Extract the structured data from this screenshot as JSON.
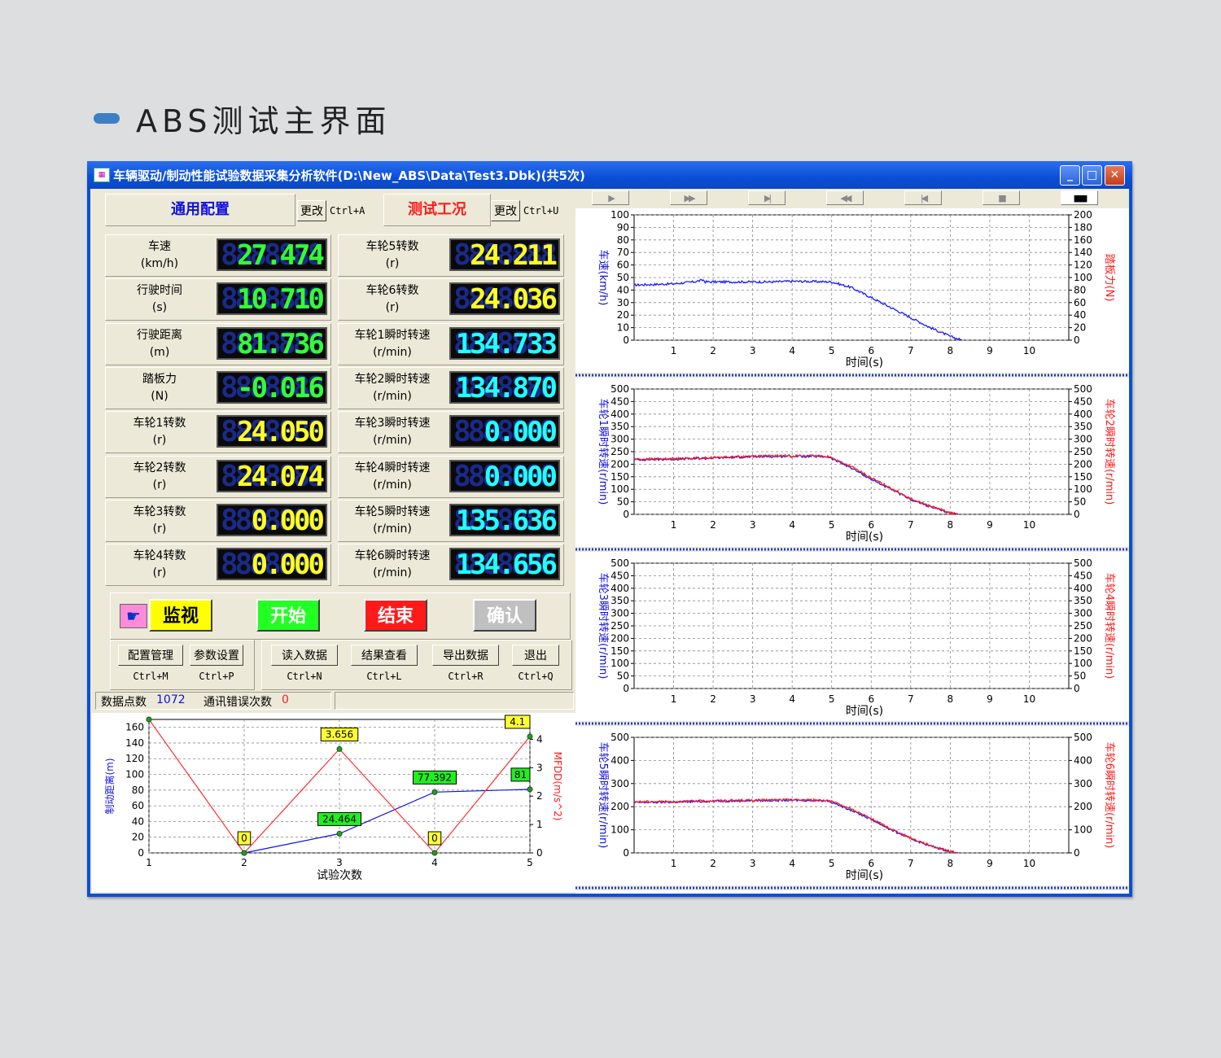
{
  "caption": "ABS测试主界面",
  "window": {
    "title": "车辆驱动/制动性能试验数据采集分析软件(D:\\New_ABS\\Data\\Test3.Dbk)(共5次)",
    "controls": {
      "minimize": "_",
      "maximize": "□",
      "close": "✕"
    }
  },
  "config": {
    "general_label": "通用配置",
    "general_change": "更改",
    "general_hotkey": "Ctrl+A",
    "test_label": "测试工况",
    "test_change": "更改",
    "test_hotkey": "Ctrl+U"
  },
  "meters": [
    {
      "label": "车速",
      "unit": "(km/h)",
      "value": "27.474",
      "color": "#33ff33"
    },
    {
      "label": "车轮5转数",
      "unit": "(r)",
      "value": "24.211",
      "color": "#ffff22"
    },
    {
      "label": "行驶时间",
      "unit": "(s)",
      "value": "10.710",
      "color": "#33ff33"
    },
    {
      "label": "车轮6转数",
      "unit": "(r)",
      "value": "24.036",
      "color": "#ffff22"
    },
    {
      "label": "行驶距离",
      "unit": "(m)",
      "value": "81.736",
      "color": "#33ff33"
    },
    {
      "label": "车轮1瞬时转速",
      "unit": "(r/min)",
      "value": "134.733",
      "color": "#22ffff"
    },
    {
      "label": "踏板力",
      "unit": "(N)",
      "value": "-0.016",
      "color": "#33ff33"
    },
    {
      "label": "车轮2瞬时转速",
      "unit": "(r/min)",
      "value": "134.870",
      "color": "#22ffff"
    },
    {
      "label": "车轮1转数",
      "unit": "(r)",
      "value": "24.050",
      "color": "#ffff22"
    },
    {
      "label": "车轮3瞬时转速",
      "unit": "(r/min)",
      "value": "0.000",
      "color": "#22ffff"
    },
    {
      "label": "车轮2转数",
      "unit": "(r)",
      "value": "24.074",
      "color": "#ffff22"
    },
    {
      "label": "车轮4瞬时转速",
      "unit": "(r/min)",
      "value": "0.000",
      "color": "#22ffff"
    },
    {
      "label": "车轮3转数",
      "unit": "(r)",
      "value": "0.000",
      "color": "#ffff22"
    },
    {
      "label": "车轮5瞬时转速",
      "unit": "(r/min)",
      "value": "135.636",
      "color": "#22ffff"
    },
    {
      "label": "车轮4转数",
      "unit": "(r)",
      "value": "0.000",
      "color": "#ffff22"
    },
    {
      "label": "车轮6瞬时转速",
      "unit": "(r/min)",
      "value": "134.656",
      "color": "#22ffff"
    }
  ],
  "actions": {
    "hand_icon": "pointing-hand-icon",
    "monitor": {
      "label": "监视",
      "bg": "#ffff00",
      "fg": "#000000"
    },
    "start": {
      "label": "开始",
      "bg": "#22ff22",
      "fg": "#ffffff"
    },
    "end": {
      "label": "结束",
      "bg": "#ff1a1a",
      "fg": "#ffffff"
    },
    "confirm": {
      "label": "确认",
      "bg": "#c0c0c0",
      "fg": "#ffffff"
    }
  },
  "menu_buttons": [
    {
      "label": "配置管理",
      "hotkey": "Ctrl+M"
    },
    {
      "label": "参数设置",
      "hotkey": "Ctrl+P"
    },
    {
      "label": "读入数据",
      "hotkey": "Ctrl+N"
    },
    {
      "label": "结果查看",
      "hotkey": "Ctrl+L"
    },
    {
      "label": "导出数据",
      "hotkey": "Ctrl+R"
    },
    {
      "label": "退出",
      "hotkey": "Ctrl+Q"
    }
  ],
  "status": {
    "points_label": "数据点数",
    "points_value": "1072",
    "errors_label": "通讯错误次数",
    "errors_value": "0"
  },
  "playback_icons": [
    "play-icon",
    "fast-forward-icon",
    "skip-end-icon",
    "rewind-icon",
    "skip-start-icon",
    "stop-icon",
    "pause-icon"
  ],
  "chart_data": [
    {
      "id": "summary",
      "type": "line",
      "xlabel": "试验次数",
      "ylabel_left": "制动距离(m)",
      "ylabel_right": "MFDD(m/s^2)",
      "x": [
        1,
        2,
        3,
        4,
        5
      ],
      "xlim": [
        1,
        5
      ],
      "ylim_left": [
        0,
        170
      ],
      "ylim_right": [
        0,
        4.7
      ],
      "yticks_left": [
        0,
        20,
        40,
        60,
        80,
        100,
        120,
        140,
        160
      ],
      "yticks_right": [
        0,
        1,
        2,
        3,
        4
      ],
      "series": [
        {
          "axis": "left",
          "color": "#1010e0",
          "values": [
            null,
            0,
            24.464,
            77.392,
            81
          ],
          "labels": [
            "",
            "",
            "24.464",
            "77.392",
            "81"
          ]
        },
        {
          "axis": "right",
          "color": "#ff3030",
          "values": [
            4.7,
            0,
            3.656,
            0,
            4.1
          ],
          "labels": [
            "",
            "0",
            "3.656",
            "0",
            "4.1"
          ]
        }
      ],
      "grid": true
    },
    {
      "id": "speed",
      "type": "line",
      "xlabel": "时间(s)",
      "ylabel_left": "车速(km/h)",
      "ylabel_right": "踏板力(N)",
      "xlim": [
        0,
        11
      ],
      "ylim_left": [
        0,
        100
      ],
      "ylim_right": [
        0,
        200
      ],
      "xticks": [
        1,
        2,
        3,
        4,
        5,
        6,
        7,
        8,
        9,
        10
      ],
      "yticks_left": [
        0,
        10,
        20,
        30,
        40,
        50,
        60,
        70,
        80,
        90,
        100
      ],
      "yticks_right": [
        0,
        20,
        40,
        60,
        80,
        100,
        120,
        140,
        160,
        180,
        200
      ],
      "series": [
        {
          "axis": "left",
          "color": "#1a1aff",
          "x": [
            0,
            0.5,
            1,
            1.5,
            1.75,
            1.8,
            2,
            2.5,
            3,
            3.5,
            4,
            4.5,
            5,
            5.5,
            6,
            6.5,
            7,
            7.5,
            8,
            8.3
          ],
          "values": [
            44,
            44.5,
            45,
            46.5,
            48,
            46.5,
            46.5,
            46.5,
            46.5,
            46.5,
            47,
            46.8,
            46.5,
            42,
            34,
            26,
            18,
            10,
            3,
            0
          ]
        }
      ],
      "grid": true
    },
    {
      "id": "wheel12",
      "type": "line",
      "xlabel": "时间(s)",
      "ylabel_left": "车轮1瞬时转速(r/min)",
      "ylabel_right": "车轮2瞬时转速(r/min)",
      "xlim": [
        0,
        11
      ],
      "ylim_left": [
        0,
        500
      ],
      "ylim_right": [
        0,
        500
      ],
      "xticks": [
        1,
        2,
        3,
        4,
        5,
        6,
        7,
        8,
        9,
        10
      ],
      "yticks_left": [
        0,
        50,
        100,
        150,
        200,
        250,
        300,
        350,
        400,
        450,
        500
      ],
      "yticks_right": [
        0,
        50,
        100,
        150,
        200,
        250,
        300,
        350,
        400,
        450,
        500
      ],
      "series": [
        {
          "axis": "left",
          "color": "#1a1aff",
          "x": [
            0,
            1,
            2,
            3,
            4,
            4.9,
            5.5,
            6,
            6.5,
            7,
            7.5,
            8,
            8.2
          ],
          "values": [
            218,
            220,
            225,
            230,
            232,
            230,
            185,
            140,
            100,
            60,
            30,
            5,
            0
          ]
        },
        {
          "axis": "right",
          "color": "#ff1a1a",
          "x": [
            0,
            1,
            2,
            3,
            4,
            4.9,
            5.5,
            6,
            6.5,
            7,
            7.5,
            8,
            8.2
          ],
          "values": [
            220,
            222,
            226,
            232,
            234,
            232,
            190,
            145,
            105,
            62,
            32,
            6,
            0
          ]
        }
      ],
      "grid": true
    },
    {
      "id": "wheel34",
      "type": "line",
      "xlabel": "时间(s)",
      "ylabel_left": "车轮3瞬时转速(r/min)",
      "ylabel_right": "车轮4瞬时转速(r/min)",
      "xlim": [
        0,
        11
      ],
      "ylim_left": [
        0,
        500
      ],
      "ylim_right": [
        0,
        500
      ],
      "xticks": [
        1,
        2,
        3,
        4,
        5,
        6,
        7,
        8,
        9,
        10
      ],
      "yticks_left": [
        0,
        50,
        100,
        150,
        200,
        250,
        300,
        350,
        400,
        450,
        500
      ],
      "yticks_right": [
        0,
        50,
        100,
        150,
        200,
        250,
        300,
        350,
        400,
        450,
        500
      ],
      "series": [],
      "grid": true
    },
    {
      "id": "wheel56",
      "type": "line",
      "xlabel": "时间(s)",
      "ylabel_left": "车轮5瞬时转速(r/min)",
      "ylabel_right": "车轮6瞬时转速(r/min)",
      "xlim": [
        0,
        11
      ],
      "ylim_left": [
        0,
        500
      ],
      "ylim_right": [
        0,
        500
      ],
      "xticks": [
        1,
        2,
        3,
        4,
        5,
        6,
        7,
        8,
        9,
        10
      ],
      "yticks_left": [
        0,
        100,
        200,
        300,
        400,
        500
      ],
      "yticks_right": [
        0,
        100,
        200,
        300,
        400,
        500
      ],
      "series": [
        {
          "axis": "left",
          "color": "#1a1aff",
          "x": [
            0,
            1,
            2,
            3,
            4,
            4.9,
            5.5,
            6,
            6.5,
            7,
            7.5,
            8,
            8.2
          ],
          "values": [
            218,
            220,
            224,
            226,
            228,
            226,
            185,
            145,
            100,
            62,
            30,
            6,
            0
          ]
        },
        {
          "axis": "right",
          "color": "#ff1a1a",
          "x": [
            0,
            1,
            2,
            3,
            4,
            4.9,
            5.5,
            6,
            6.5,
            7,
            7.5,
            8,
            8.2
          ],
          "values": [
            222,
            222,
            226,
            228,
            230,
            228,
            190,
            148,
            104,
            64,
            32,
            7,
            0
          ]
        }
      ],
      "grid": true
    }
  ]
}
